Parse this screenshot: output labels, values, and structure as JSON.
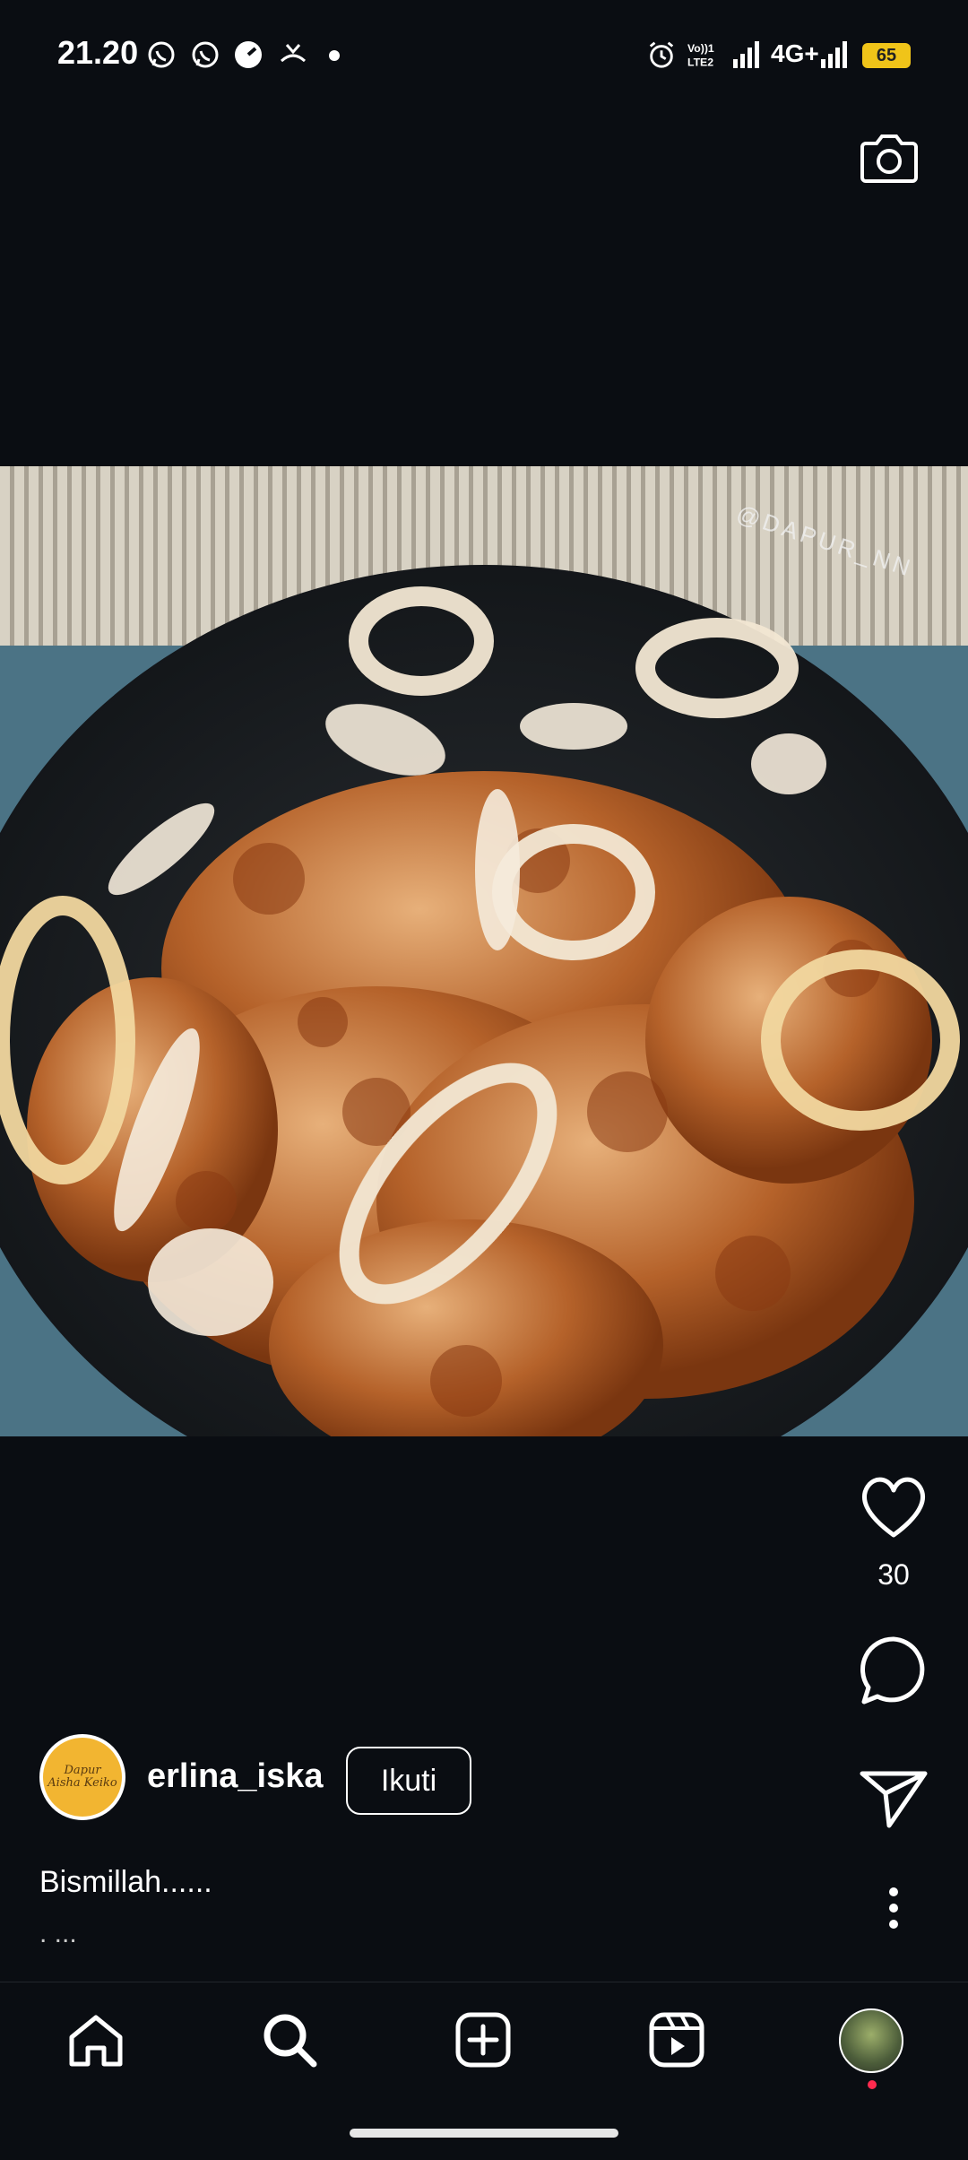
{
  "status_bar": {
    "time": "21.20",
    "network": "4G+",
    "battery": "65",
    "left_icons": [
      "whatsapp-icon",
      "whatsapp-icon",
      "speed-icon",
      "missed-call-icon",
      "dot-icon"
    ],
    "right_icons": [
      "alarm-icon",
      "volte-icon",
      "signal-icon",
      "signal-icon"
    ]
  },
  "photo": {
    "watermark": "@DAPUR_NN",
    "description_icon": "food-photo"
  },
  "actions": {
    "like_count": "30",
    "icons": [
      "heart-icon",
      "comment-icon",
      "share-icon",
      "more-icon"
    ]
  },
  "post": {
    "username": "erlina_iska",
    "follow_label": "Ikuti",
    "caption": "Bismillah......",
    "more_text": ". ..."
  },
  "avatar": {
    "line1": "Dapur",
    "line2": "Aisha Keiko"
  },
  "nav": {
    "items": [
      "home-icon",
      "search-icon",
      "add-icon",
      "reels-icon",
      "profile-avatar"
    ]
  },
  "colors": {
    "background": "#0a0d12",
    "battery": "#f0c419",
    "notification_dot": "#ff2b4f"
  }
}
